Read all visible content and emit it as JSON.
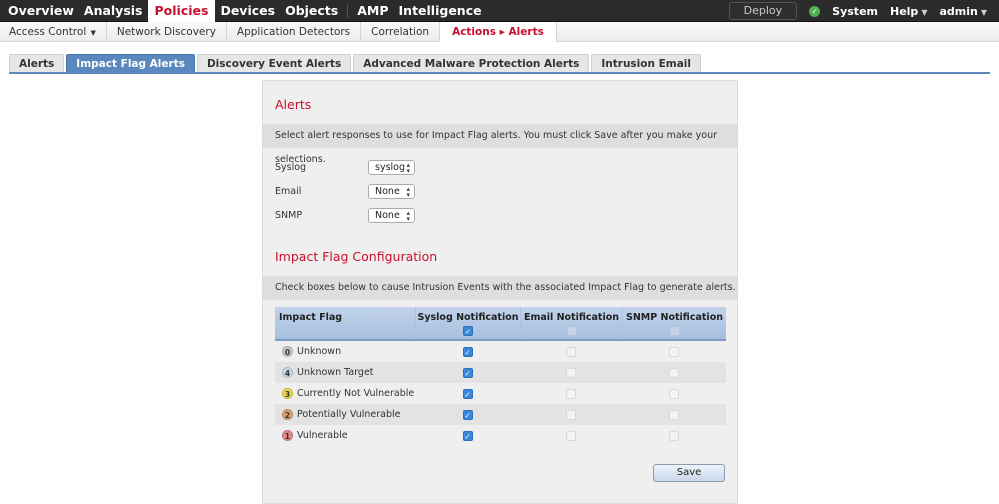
{
  "topnav": {
    "items": [
      "Overview",
      "Analysis",
      "Policies",
      "Devices",
      "Objects",
      "AMP",
      "Intelligence"
    ],
    "active": "Policies",
    "deploy_label": "Deploy",
    "status_icon": "check-circle-icon",
    "system_label": "System",
    "help_label": "Help",
    "user_label": "admin"
  },
  "subnav": {
    "items": [
      "Access Control",
      "Network Discovery",
      "Application Detectors",
      "Correlation",
      "Actions ▸ Alerts"
    ],
    "active": "Actions ▸ Alerts"
  },
  "tabs": {
    "items": [
      "Alerts",
      "Impact Flag Alerts",
      "Discovery Event Alerts",
      "Advanced Malware Protection Alerts",
      "Intrusion Email"
    ],
    "active": "Impact Flag Alerts"
  },
  "alerts_section": {
    "title": "Alerts",
    "description": "Select alert responses to use for Impact Flag alerts. You must click Save after you make your selections.",
    "fields": [
      {
        "label": "Syslog",
        "value": "syslog"
      },
      {
        "label": "Email",
        "value": "None"
      },
      {
        "label": "SNMP",
        "value": "None"
      }
    ]
  },
  "config_section": {
    "title": "Impact Flag Configuration",
    "description": "Check boxes below to cause Intrusion Events with the associated Impact Flag to generate alerts.",
    "columns": [
      "Impact Flag",
      "Syslog Notification",
      "Email Notification",
      "SNMP Notification"
    ],
    "header_checks": {
      "syslog": true,
      "email": false,
      "snmp": false
    },
    "rows": [
      {
        "flag": "0",
        "label": "Unknown",
        "color": "#c8c8c8",
        "syslog": true,
        "email": false,
        "snmp": false
      },
      {
        "flag": "4",
        "label": "Unknown Target",
        "color": "#c9d6e6",
        "syslog": true,
        "email": false,
        "snmp": false
      },
      {
        "flag": "3",
        "label": "Currently Not Vulnerable",
        "color": "#e8d84a",
        "syslog": true,
        "email": false,
        "snmp": false
      },
      {
        "flag": "2",
        "label": "Potentially Vulnerable",
        "color": "#dba36c",
        "syslog": true,
        "email": false,
        "snmp": false
      },
      {
        "flag": "1",
        "label": "Vulnerable",
        "color": "#e08a8a",
        "syslog": true,
        "email": false,
        "snmp": false
      }
    ],
    "save_label": "Save"
  }
}
